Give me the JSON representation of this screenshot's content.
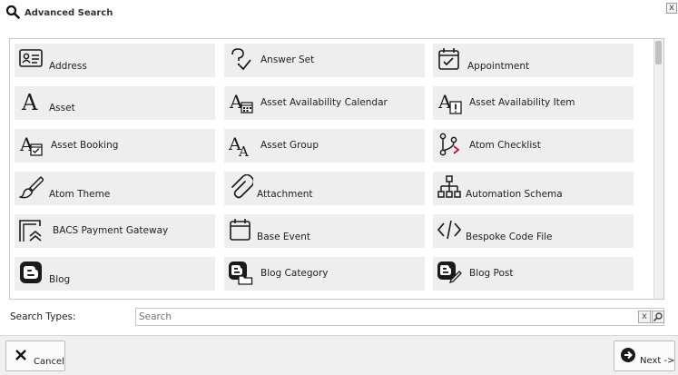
{
  "dialog": {
    "title": "Advanced Search",
    "title_icon": "search-icon",
    "close_label": "x"
  },
  "types": [
    {
      "label": "Address",
      "icon": "contact-card-icon"
    },
    {
      "label": "Answer Set",
      "icon": "answer-set-icon"
    },
    {
      "label": "Appointment",
      "icon": "calendar-check-icon"
    },
    {
      "label": "Asset",
      "icon": "letter-a-icon"
    },
    {
      "label": "Asset Availability Calendar",
      "icon": "asset-calendar-icon"
    },
    {
      "label": "Asset Availability Item",
      "icon": "asset-alert-icon"
    },
    {
      "label": "Asset Booking",
      "icon": "asset-booking-icon"
    },
    {
      "label": "Asset Group",
      "icon": "asset-group-icon"
    },
    {
      "label": "Atom Checklist",
      "icon": "branch-icon"
    },
    {
      "label": "Atom Theme",
      "icon": "brush-icon"
    },
    {
      "label": "Attachment",
      "icon": "paperclip-icon"
    },
    {
      "label": "Automation Schema",
      "icon": "sitemap-icon"
    },
    {
      "label": "BACS Payment Gateway",
      "icon": "gateway-icon"
    },
    {
      "label": "Base Event",
      "icon": "calendar-icon"
    },
    {
      "label": "Bespoke Code File",
      "icon": "code-icon"
    },
    {
      "label": "Blog",
      "icon": "blog-icon"
    },
    {
      "label": "Blog Category",
      "icon": "blog-folder-icon"
    },
    {
      "label": "Blog Post",
      "icon": "blog-edit-icon"
    }
  ],
  "search": {
    "label": "Search Types:",
    "placeholder": "Search",
    "clear_label": "x"
  },
  "footer": {
    "cancel_label": "Cancel",
    "next_label": "Next ->"
  },
  "colors": {
    "tile_bg": "#eeeeee",
    "icon": "#1a1a1a",
    "branch_accent": "#c0103a"
  }
}
